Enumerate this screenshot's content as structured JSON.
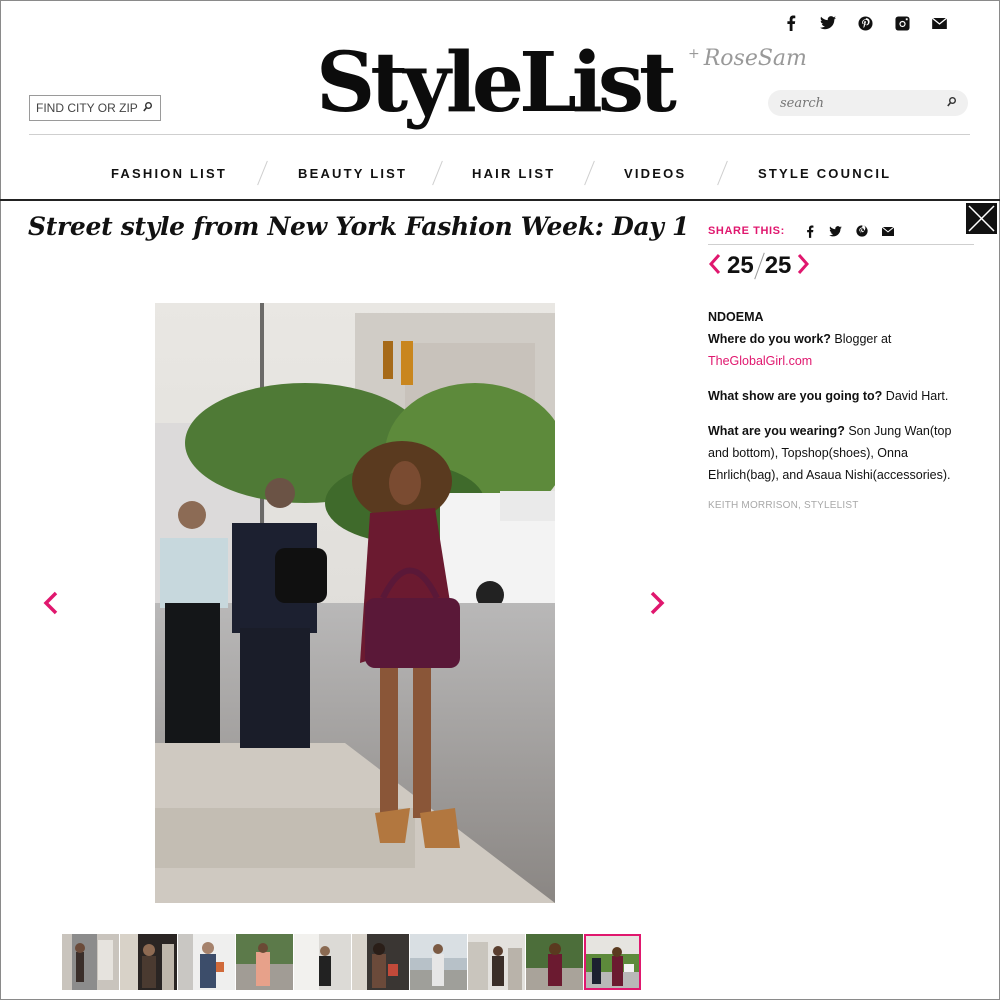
{
  "brand": {
    "logo": "StyleList",
    "partner_signature": "RoseSam"
  },
  "social_icons": [
    "facebook-icon",
    "twitter-icon",
    "pinterest-icon",
    "instagram-icon",
    "mail-icon"
  ],
  "city_search": {
    "placeholder": "FIND CITY OR ZIP"
  },
  "search": {
    "placeholder": "search"
  },
  "nav": [
    {
      "label": "FASHION LIST"
    },
    {
      "label": "BEAUTY LIST"
    },
    {
      "label": "HAIR LIST"
    },
    {
      "label": "VIDEOS"
    },
    {
      "label": "STYLE COUNCIL"
    }
  ],
  "gallery": {
    "title": "Street style from New York Fashion Week: Day 1",
    "current": "25",
    "total": "25",
    "thumbnail_count": 10,
    "active_thumbnail": 10
  },
  "share": {
    "label": "SHARE THIS:",
    "icons": [
      "facebook-icon",
      "twitter-icon",
      "pinterest-icon",
      "mail-icon"
    ]
  },
  "caption": {
    "name": "NDOEMA",
    "work_q": "Where do you work?",
    "work_a": "Blogger at",
    "work_link": "TheGlobalGirl.com",
    "show_q": "What show are you going to?",
    "show_a": "David Hart.",
    "wear_q": "What are you wearing?",
    "wear_a": "Son Jung Wan(top and bottom), Topshop(shoes), Onna Ehrlich(bag), and Asaua Nishi(accessories).",
    "credit": "KEITH MORRISON, STYLELIST"
  },
  "colors": {
    "accent": "#e0176e",
    "text": "#111111",
    "muted": "#a8a8a8"
  }
}
